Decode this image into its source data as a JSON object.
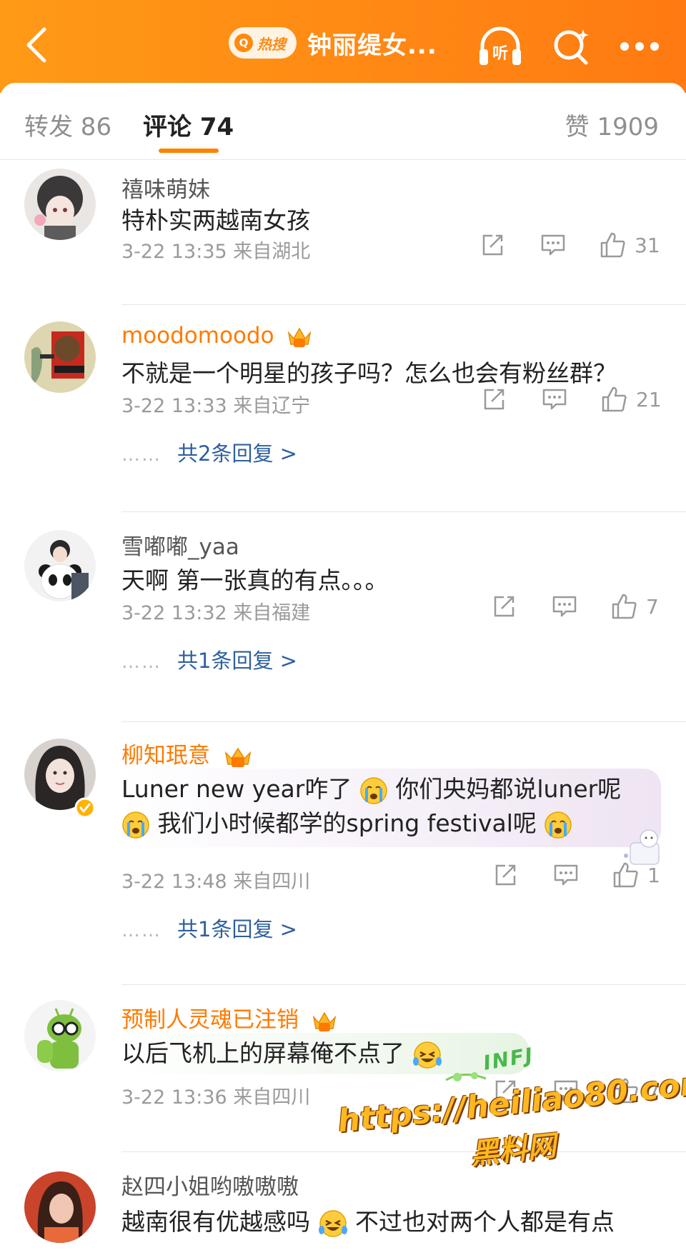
{
  "header": {
    "hot_label": "热搜",
    "title": "钟丽缇女...",
    "listen_label": "听"
  },
  "tabs": {
    "repost": "转发 86",
    "comments": "评论 74",
    "likes": "赞 1909"
  },
  "comments": [
    {
      "name": "禧味萌妹",
      "vip": false,
      "text": "特朴实两越南女孩",
      "meta": "3-22 13:35 来自湖北",
      "likes": "31"
    },
    {
      "name": "moodomoodo",
      "vip": true,
      "text": "不就是一个明星的孩子吗？怎么也会有粉丝群？",
      "meta": "3-22 13:33 来自辽宁",
      "likes": "21",
      "replies": "共2条回复 >"
    },
    {
      "name": "雪嘟嘟_yaa",
      "vip": false,
      "text": "天啊 第一张真的有点。。。",
      "meta": "3-22 13:32 来自福建",
      "likes": "7",
      "replies": "共1条回复 >"
    },
    {
      "name": "柳知珉意",
      "vip": true,
      "text_line1_a": "Luner new year咋了",
      "text_line1_b": "你们央妈都说luner呢",
      "text_line2": "我们小时候都学的spring festival呢",
      "meta": "3-22 13:48 来自四川",
      "likes": "1",
      "replies": "共1条回复 >"
    },
    {
      "name": "预制人灵魂已注销",
      "vip": true,
      "text": "以后飞机上的屏幕俺不点了",
      "sticker": "INFJ",
      "meta": "3-22 13:36 来自四川",
      "likes": "7"
    },
    {
      "name": "赵四小姐哟嗷嗷嗷",
      "vip": false,
      "text_a": "越南很有优越感吗",
      "text_b": "不过也对两个人都是有点"
    }
  ],
  "reply_dots": "……",
  "watermark": {
    "line1": "https://heiliao80.com",
    "line2": "黑料网"
  },
  "colors": {
    "header_orange": "#ff8a12",
    "tab_underline": "#ff8200",
    "vip_name": "#ff7a00",
    "reply_link": "#2e5f9e"
  },
  "icons": [
    "back-icon",
    "listen-icon",
    "search-icon",
    "more-icon",
    "share-icon",
    "comment-icon",
    "like-icon",
    "crown-icon",
    "verified-icon",
    "crying-emoji-icon",
    "laughing-crying-emoji-icon"
  ]
}
